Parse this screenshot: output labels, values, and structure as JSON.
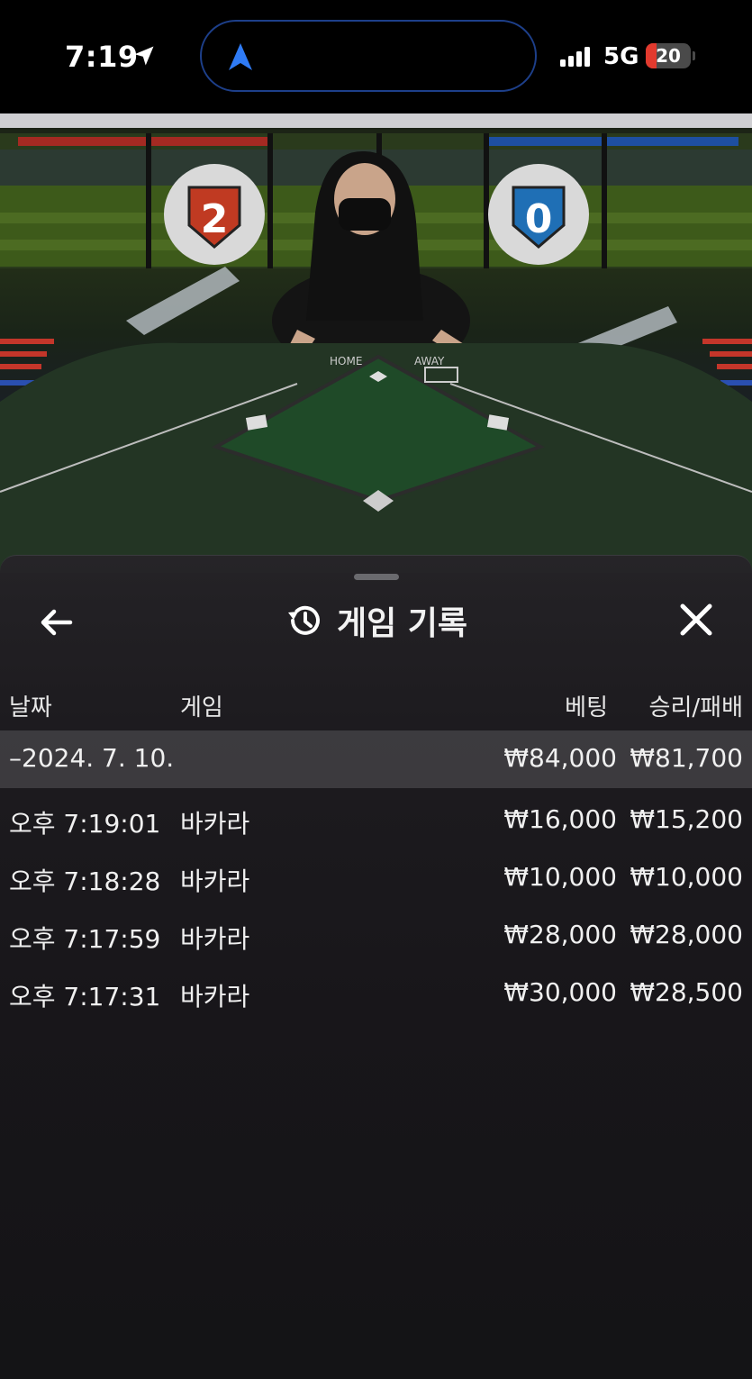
{
  "status_bar": {
    "time": "7:19",
    "network": "5G",
    "battery": "20",
    "battery_level_percent": 20
  },
  "sheet": {
    "title": "게임 기록",
    "headers": {
      "date": "날짜",
      "game": "게임",
      "bet": "베팅",
      "win_loss": "승리/패배"
    },
    "date_group": {
      "label": "–2024. 7. 10.",
      "bet": "₩84,000",
      "win_loss": "₩81,700"
    },
    "rows": [
      {
        "time": "오후 7:19:01",
        "game": "바카라",
        "bet": "₩16,000",
        "win_loss": "₩15,200"
      },
      {
        "time": "오후 7:18:28",
        "game": "바카라",
        "bet": "₩10,000",
        "win_loss": "₩10,000"
      },
      {
        "time": "오후 7:17:59",
        "game": "바카라",
        "bet": "₩28,000",
        "win_loss": "₩28,000"
      },
      {
        "time": "오후 7:17:31",
        "game": "바카라",
        "bet": "₩30,000",
        "win_loss": "₩28,500"
      }
    ]
  },
  "video": {
    "home_score": "2",
    "away_score": "0",
    "home_label": "HOME",
    "away_label": "AWAY"
  },
  "icons": {
    "location": "location-arrow-icon",
    "navigation": "navigation-arrow-icon",
    "back": "arrow-left-icon",
    "history": "history-icon",
    "close": "close-icon"
  },
  "colors": {
    "battery_low": "#e23a2e",
    "nav_blue": "#2f7bf5",
    "home_red": "#c03a22",
    "away_blue": "#1f6fb5"
  }
}
